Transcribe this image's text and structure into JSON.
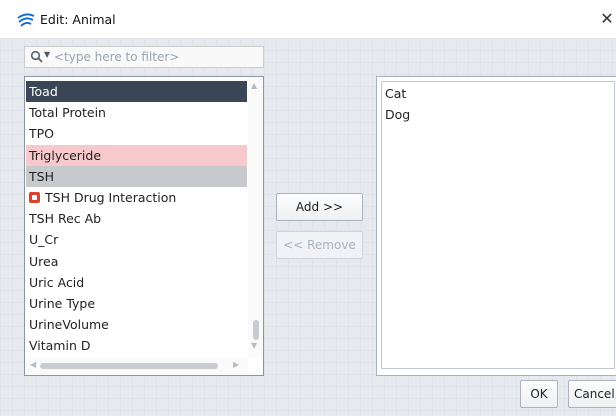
{
  "window": {
    "title": "Edit: Animal",
    "close_glyph": "✕"
  },
  "filter": {
    "placeholder": "<type here to filter>",
    "value": ""
  },
  "available_items": [
    {
      "label": "Toad",
      "state": "selected"
    },
    {
      "label": "Total Protein",
      "state": "normal"
    },
    {
      "label": "TPO",
      "state": "normal"
    },
    {
      "label": "Triglyceride",
      "state": "highlight-pink"
    },
    {
      "label": "TSH",
      "state": "highlight-gray"
    },
    {
      "label": "TSH Drug Interaction",
      "state": "normal",
      "icon": "red-tag-icon"
    },
    {
      "label": "TSH Rec Ab",
      "state": "normal"
    },
    {
      "label": "U_Cr",
      "state": "normal"
    },
    {
      "label": "Urea",
      "state": "normal"
    },
    {
      "label": "Uric Acid",
      "state": "normal"
    },
    {
      "label": "Urine Type",
      "state": "normal"
    },
    {
      "label": "UrineVolume",
      "state": "normal"
    },
    {
      "label": "Vitamin D",
      "state": "normal"
    }
  ],
  "selected_items": [
    {
      "label": "Cat"
    },
    {
      "label": "Dog"
    }
  ],
  "buttons": {
    "add": "Add >>",
    "remove": "<< Remove",
    "ok": "OK",
    "cancel": "Cancel"
  },
  "colors": {
    "selection": "#3a4556",
    "pink_highlight": "#f7c9cc",
    "gray_highlight": "#c7c9cc",
    "icon_red": "#d9432e",
    "app_icon_blue": "#1c6fd1"
  }
}
